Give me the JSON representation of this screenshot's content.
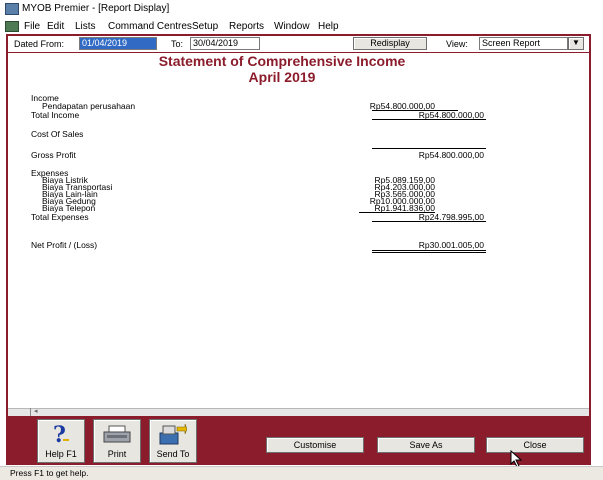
{
  "window": {
    "title": "MYOB Premier - [Report Display]"
  },
  "menu": [
    "File",
    "Edit",
    "Lists",
    "Command Centres",
    "Setup",
    "Reports",
    "Window",
    "Help"
  ],
  "toolbar": {
    "dated_from_label": "Dated From:",
    "dated_from_value": "01/04/2019",
    "to_label": "To:",
    "to_value": "30/04/2019",
    "redisplay_label": "Redisplay",
    "view_label": "View:",
    "view_value": "Screen Report"
  },
  "report": {
    "title": "Statement of Comprehensive Income",
    "period": "April 2019",
    "income_header": "Income",
    "income_lines": [
      {
        "label": "Pendapatan perusahaan",
        "amount": "Rp54.800.000,00"
      }
    ],
    "total_income_label": "Total Income",
    "total_income": "Rp54.800.000,00",
    "cost_of_sales_label": "Cost Of Sales",
    "gross_profit_label": "Gross Profit",
    "gross_profit": "Rp54.800.000,00",
    "expenses_header": "Expenses",
    "expense_lines": [
      {
        "label": "Biaya Listrik",
        "amount": "Rp5.089.159,00"
      },
      {
        "label": "Biaya Transportasi",
        "amount": "Rp4.203.000,00"
      },
      {
        "label": "Biaya Lain-lain",
        "amount": "Rp3.565.000,00"
      },
      {
        "label": "Biaya Gedung",
        "amount": "Rp10.000.000,00"
      },
      {
        "label": "Biaya Telepon",
        "amount": "Rp1.941.836,00"
      }
    ],
    "total_expenses_label": "Total Expenses",
    "total_expenses": "Rp24.798.995,00",
    "net_profit_label": "Net Profit / (Loss)",
    "net_profit": "Rp30.001.005,00"
  },
  "bottom": {
    "help_label": "Help F1",
    "print_label": "Print",
    "send_label": "Send To",
    "customise_label": "Customise",
    "save_as_label": "Save As",
    "close_label": "Close"
  },
  "status": {
    "text": "Press F1 to get help."
  }
}
